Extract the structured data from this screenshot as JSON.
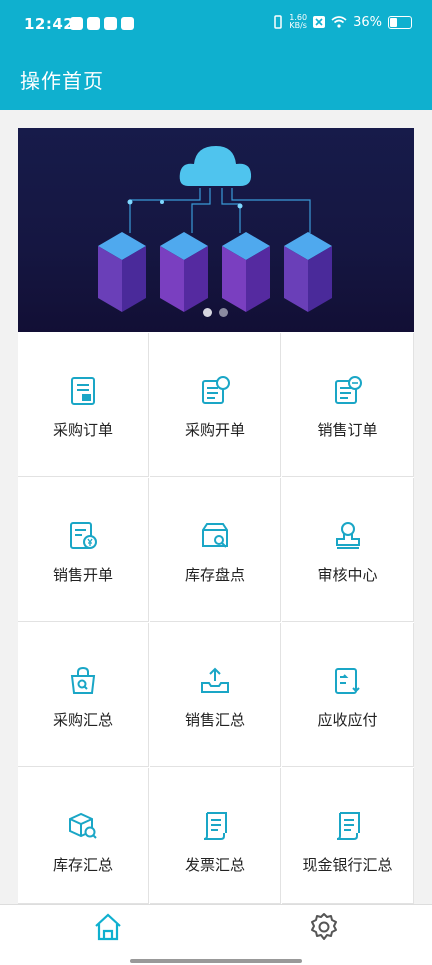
{
  "status": {
    "time": "12:42",
    "net_speed_value": "1.60",
    "net_speed_unit": "KB/s",
    "battery": "36%"
  },
  "header": {
    "title": "操作首页"
  },
  "banner": {
    "slide_count": 2,
    "active_slide": 1
  },
  "menu": [
    {
      "label": "采购订单",
      "icon": "purchase-order-icon"
    },
    {
      "label": "采购开单",
      "icon": "purchase-bill-icon"
    },
    {
      "label": "销售订单",
      "icon": "sales-order-icon"
    },
    {
      "label": "销售开单",
      "icon": "sales-bill-icon"
    },
    {
      "label": "库存盘点",
      "icon": "inventory-check-icon"
    },
    {
      "label": "审核中心",
      "icon": "audit-center-icon"
    },
    {
      "label": "采购汇总",
      "icon": "purchase-summary-icon"
    },
    {
      "label": "销售汇总",
      "icon": "sales-summary-icon"
    },
    {
      "label": "应收应付",
      "icon": "receivable-payable-icon"
    },
    {
      "label": "库存汇总",
      "icon": "inventory-summary-icon"
    },
    {
      "label": "发票汇总",
      "icon": "invoice-summary-icon"
    },
    {
      "label": "现金银行汇总",
      "icon": "cash-bank-summary-icon"
    }
  ],
  "tabbar": [
    {
      "icon": "home-icon"
    },
    {
      "icon": "gear-icon"
    }
  ],
  "colors": {
    "primary": "#0fb0cf",
    "icon": "#1aa6c6"
  }
}
